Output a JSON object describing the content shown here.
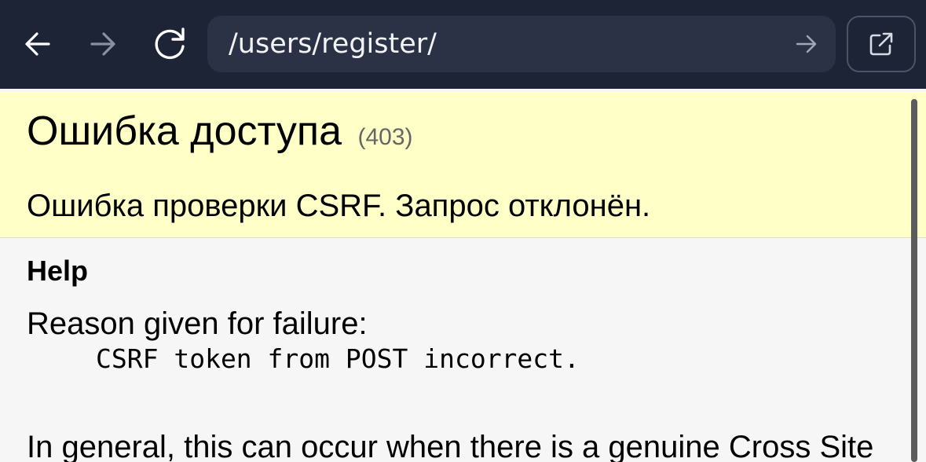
{
  "toolbar": {
    "back_icon": "arrow-left-icon",
    "forward_icon": "arrow-right-icon",
    "reload_icon": "reload-icon",
    "url": "/users/register/",
    "go_icon": "arrow-right-icon",
    "external_icon": "open-external-icon",
    "colors": {
      "background": "#1d2436",
      "url_bar": "#2b3246",
      "icon_active": "#ffffff",
      "icon_disabled": "#8a90a0"
    }
  },
  "page": {
    "title": "Ошибка доступа",
    "status_code": "(403)",
    "summary": "Ошибка проверки CSRF. Запрос отклонён.",
    "help_heading": "Help",
    "reason_label": "Reason given for failure:",
    "reason": "CSRF token from POST incorrect.",
    "general_text": "In general, this can occur when there is a genuine Cross Site",
    "colors": {
      "summary_background": "#ffffc8",
      "body_background": "#f6f6f6"
    }
  }
}
